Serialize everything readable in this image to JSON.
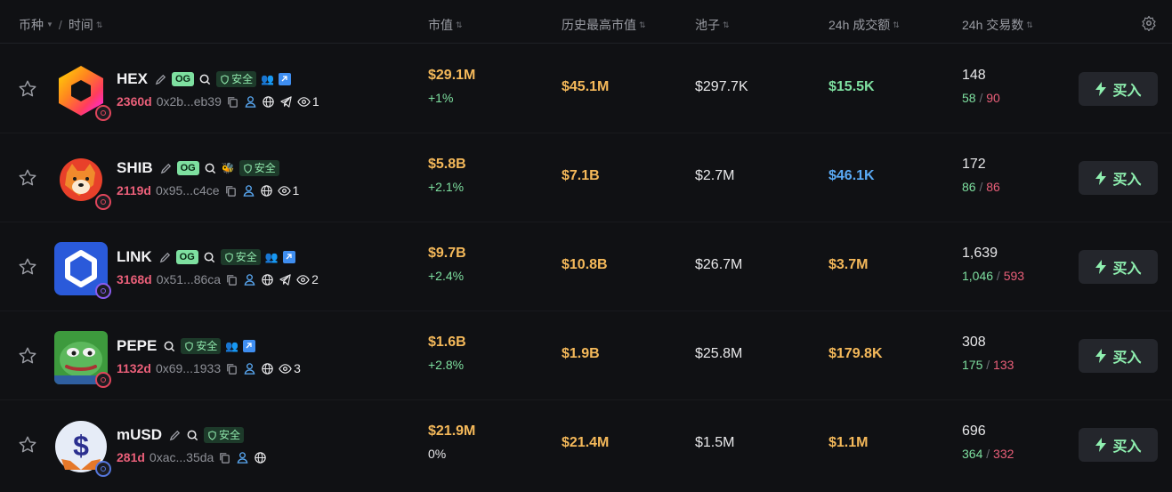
{
  "header": {
    "col_token": "币种",
    "col_sep": "/",
    "col_time": "时间",
    "col_mcap": "市值",
    "col_ath": "历史最高市值",
    "col_pool": "池子",
    "col_vol": "24h 成交额",
    "col_txns": "24h 交易数"
  },
  "labels": {
    "og": "OG",
    "safe": "安全",
    "buy": "买入"
  },
  "rows": [
    {
      "symbol": "HEX",
      "age": "2360d",
      "address": "0x2b...eb39",
      "views": "1",
      "mcap": "$29.1M",
      "change": "+1%",
      "ath": "$45.1M",
      "pool": "$297.7K",
      "volume": "$15.5K",
      "txns": "148",
      "buys": "58",
      "sells": "90"
    },
    {
      "symbol": "SHIB",
      "age": "2119d",
      "address": "0x95...c4ce",
      "views": "1",
      "mcap": "$5.8B",
      "change": "+2.1%",
      "ath": "$7.1B",
      "pool": "$2.7M",
      "volume": "$46.1K",
      "txns": "172",
      "buys": "86",
      "sells": "86"
    },
    {
      "symbol": "LINK",
      "age": "3168d",
      "address": "0x51...86ca",
      "views": "2",
      "mcap": "$9.7B",
      "change": "+2.4%",
      "ath": "$10.8B",
      "pool": "$26.7M",
      "volume": "$3.7M",
      "txns": "1,639",
      "buys": "1,046",
      "sells": "593"
    },
    {
      "symbol": "PEPE",
      "age": "1132d",
      "address": "0x69...1933",
      "views": "3",
      "mcap": "$1.6B",
      "change": "+2.8%",
      "ath": "$1.9B",
      "pool": "$25.8M",
      "volume": "$179.8K",
      "txns": "308",
      "buys": "175",
      "sells": "133"
    },
    {
      "symbol": "mUSD",
      "age": "281d",
      "address": "0xac...35da",
      "mcap": "$21.9M",
      "change": "0%",
      "ath": "$21.4M",
      "pool": "$1.5M",
      "volume": "$1.1M",
      "txns": "696",
      "buys": "364",
      "sells": "332"
    }
  ],
  "colors": {
    "accent_green": "#7ee0a0",
    "accent_orange": "#f5b95a",
    "accent_red": "#ea5f79",
    "accent_blue": "#5aaaf5",
    "bg": "#101114"
  }
}
